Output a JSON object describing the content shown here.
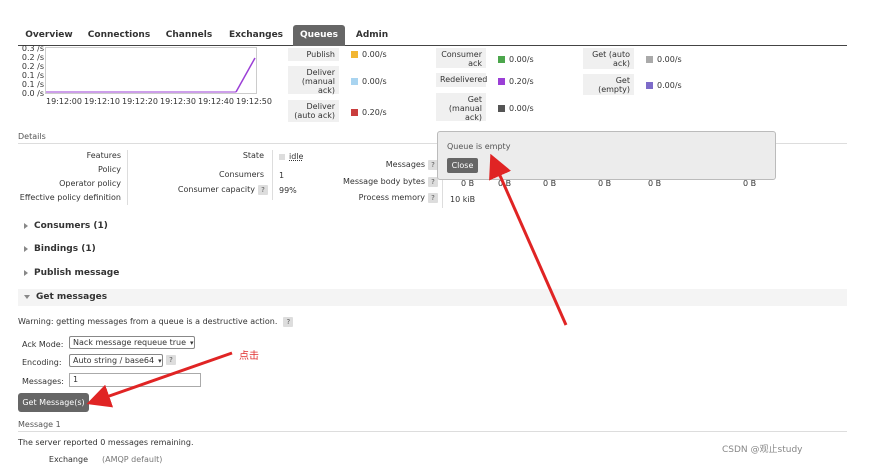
{
  "nav": {
    "tabs": [
      "Overview",
      "Connections",
      "Channels",
      "Exchanges",
      "Queues",
      "Admin"
    ],
    "active": "Queues"
  },
  "chart": {
    "y_ticks": [
      "0.3 /s",
      "0.2 /s",
      "0.2 /s",
      "0.1 /s",
      "0.1 /s",
      "0.0 /s"
    ],
    "x_ticks": [
      "19:12:00",
      "19:12:10",
      "19:12:20",
      "19:12:30",
      "19:12:40",
      "19:12:50"
    ],
    "line_color": "#9b3fd6"
  },
  "rates": {
    "col1": [
      {
        "label": "Publish",
        "value": "0.00/s",
        "color": "#f2b632"
      },
      {
        "label": "Deliver (manual ack)",
        "value": "0.00/s",
        "color": "#a9d4f0"
      },
      {
        "label": "Deliver (auto ack)",
        "value": "0.20/s",
        "color": "#c93d3d"
      }
    ],
    "col2": [
      {
        "label": "Consumer ack",
        "value": "0.00/s",
        "color": "#4ca64c"
      },
      {
        "label": "Redelivered",
        "value": "0.20/s",
        "color": "#9b3fd6"
      },
      {
        "label": "Get (manual ack)",
        "value": "0.00/s",
        "color": "#555555"
      }
    ],
    "col3": [
      {
        "label": "Get (auto ack)",
        "value": "0.00/s",
        "color": "#aaaaaa"
      },
      {
        "label": "Get (empty)",
        "value": "0.00/s",
        "color": "#7d6bc9"
      }
    ]
  },
  "details": {
    "title": "Details",
    "left_labels": [
      "Features",
      "Policy",
      "Operator policy",
      "Effective policy definition"
    ],
    "state_label": "State",
    "state_value": "idle",
    "consumers_label": "Consumers",
    "consumers_value": "1",
    "capacity_label": "Consumer capacity",
    "capacity_value": "99%",
    "messages_label": "Messages",
    "body_bytes_label": "Message body bytes",
    "body_bytes_values": [
      "0 B",
      "0 B",
      "0 B",
      "0 B",
      "0 B",
      "0 B"
    ],
    "process_memory_label": "Process memory",
    "process_memory_value": "10 kiB",
    "help": "?"
  },
  "popup": {
    "message": "Queue is empty",
    "close_label": "Close"
  },
  "sections": {
    "consumers": "Consumers (1)",
    "bindings": "Bindings (1)",
    "publish": "Publish message",
    "get": "Get messages"
  },
  "get_messages": {
    "warning": "Warning: getting messages from a queue is a destructive action.",
    "ack_mode_label": "Ack Mode:",
    "ack_mode_value": "Nack message requeue true",
    "encoding_label": "Encoding:",
    "encoding_value": "Auto string / base64",
    "messages_label": "Messages:",
    "messages_value": "1",
    "button_label": "Get Message(s)"
  },
  "result": {
    "title": "Message 1",
    "reported": "The server reported 0 messages remaining.",
    "exchange_label": "Exchange",
    "exchange_value": "(AMQP default)"
  },
  "annotation": "点击",
  "watermark": "CSDN @观止study",
  "arrow_color": "#e02424"
}
